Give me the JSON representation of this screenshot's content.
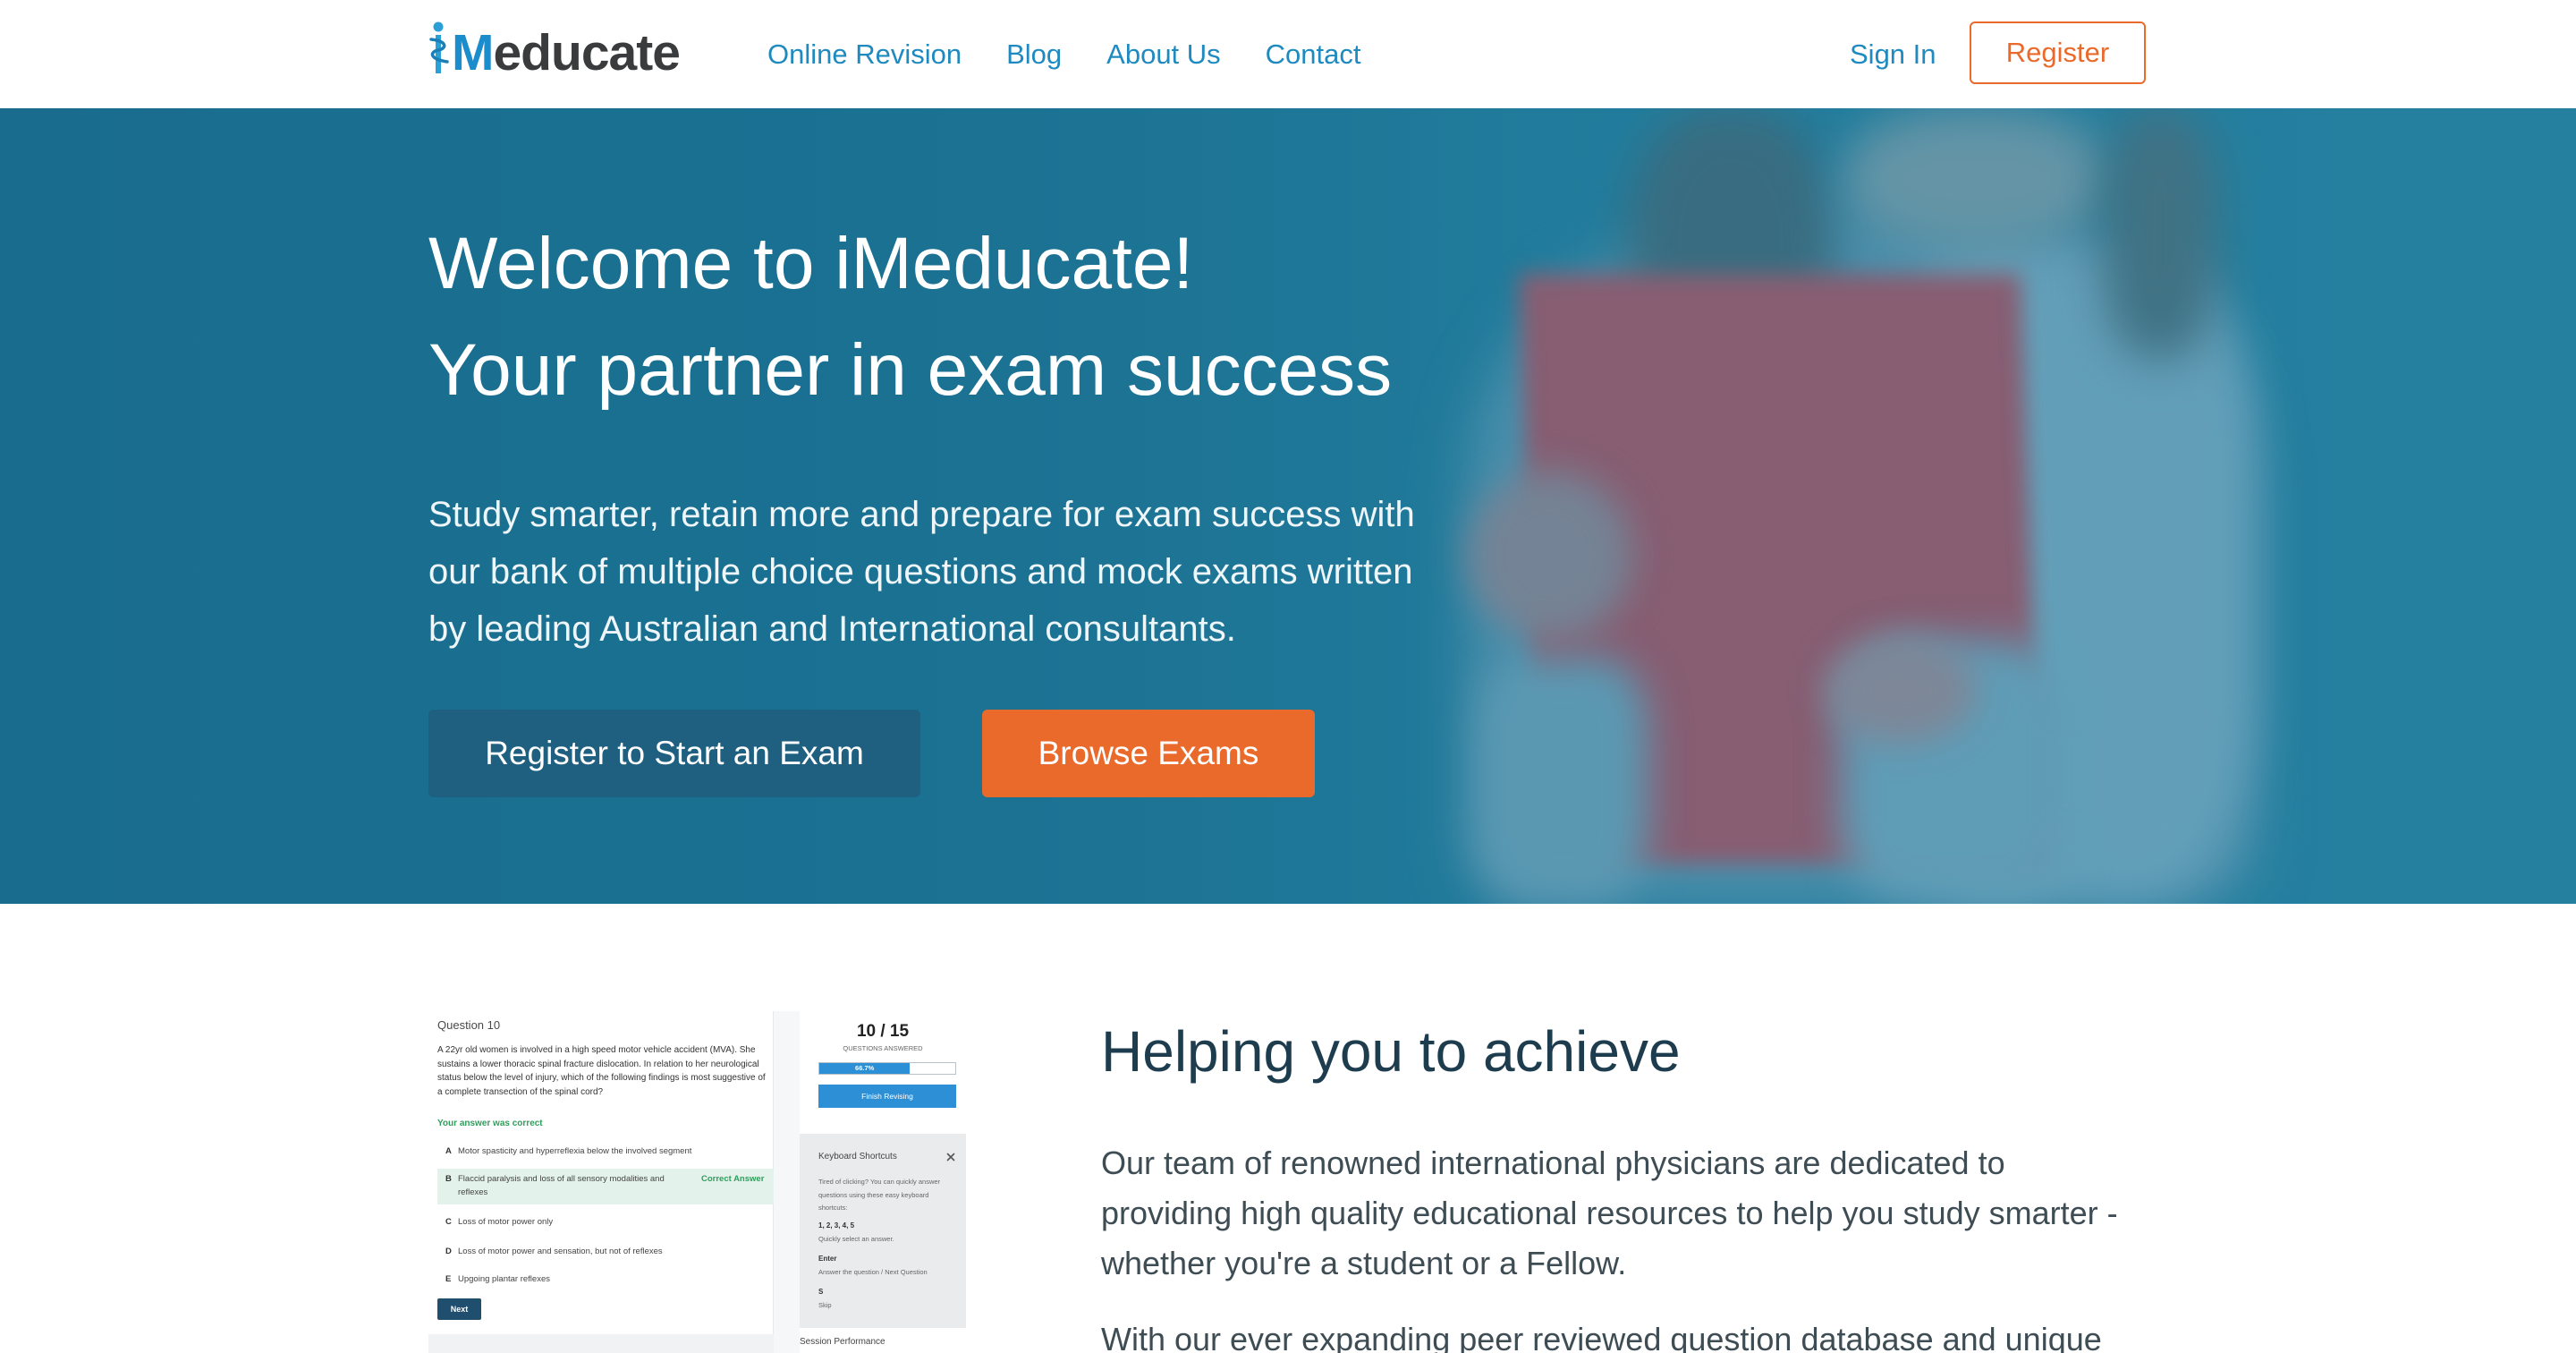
{
  "logo": {
    "accent": "M",
    "rest": "educate",
    "icon": "caduceus-i-icon"
  },
  "nav": {
    "items": [
      {
        "label": "Online Revision"
      },
      {
        "label": "Blog"
      },
      {
        "label": "About Us"
      },
      {
        "label": "Contact"
      }
    ],
    "sign_in": "Sign In",
    "register": "Register"
  },
  "hero": {
    "title_line1": "Welcome to iMeducate!",
    "title_line2": "Your partner in exam success",
    "description": "Study smarter, retain more and prepare for exam success with our bank of multiple choice questions and mock exams written by leading Australian and International consultants.",
    "primary_button": "Register to Start an Exam",
    "secondary_button": "Browse Exams"
  },
  "achieve": {
    "heading": "Helping you to achieve",
    "paragraphs": [
      "Our team of renowned international physicians are dedicated to providing high quality educational resources to help you study smarter - whether you're a student or a Fellow.",
      "With our ever expanding peer reviewed question database and unique"
    ]
  },
  "preview": {
    "question": {
      "label": "Question 10",
      "text": "A 22yr old women is involved in a high speed motor vehicle accident (MVA). She sustains a lower thoracic spinal fracture dislocation. In relation to her neurological status below the level of injury, which of the following findings is most suggestive of a complete transection of the spinal cord?",
      "feedback": "Your answer was correct",
      "options": [
        {
          "letter": "A",
          "text": "Motor spasticity and hyperreflexia below the involved segment"
        },
        {
          "letter": "B",
          "text": "Flaccid paralysis and loss of all sensory modalities and reflexes",
          "tag": "Correct Answer"
        },
        {
          "letter": "C",
          "text": "Loss of motor power only"
        },
        {
          "letter": "D",
          "text": "Loss of motor power and sensation, but not of reflexes"
        },
        {
          "letter": "E",
          "text": "Upgoing plantar reflexes"
        }
      ],
      "next_button": "Next"
    },
    "progress": {
      "count": "10 / 15",
      "caption": "QUESTIONS ANSWERED",
      "percent": 66.7,
      "percent_label": "66.7%",
      "finish_button": "Finish Revising"
    },
    "shortcuts": {
      "title": "Keyboard Shortcuts",
      "close_icon": "close-icon",
      "intro": "Tired of clicking? You can quickly answer questions using these easy keyboard shortcuts:",
      "items": [
        {
          "key": "1, 2, 3, 4, 5",
          "desc": "Quickly select an answer."
        },
        {
          "key": "Enter",
          "desc": "Answer the question / Next Question"
        },
        {
          "key": "S",
          "desc": "Skip"
        }
      ]
    },
    "session_label": "Session Performance"
  },
  "colors": {
    "brand_blue": "#1b8ccc",
    "nav_blue": "#1f8ac0",
    "accent_orange": "#ea6a2c",
    "hero_teal": "#1e7698",
    "primary_button": "#1f5f80",
    "heading_navy": "#1d3c4e",
    "success_green": "#2e9e5b"
  }
}
